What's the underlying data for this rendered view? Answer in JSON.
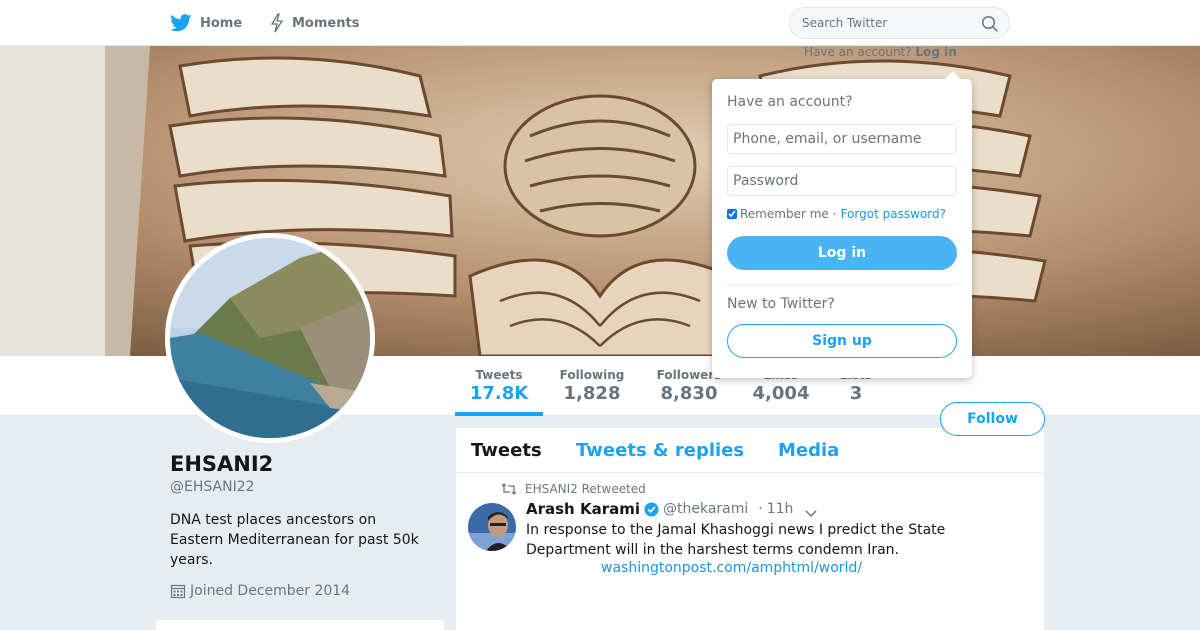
{
  "nav": {
    "home_label": "Home",
    "moments_label": "Moments",
    "search_placeholder": "Search Twitter",
    "login_prompt": "Have an account?",
    "login_link": "Log in"
  },
  "profile": {
    "name": "EHSANI2",
    "handle": "@EHSANI22",
    "bio": "DNA test places ancestors on Eastern Mediterranean for past 50k years.",
    "joined": "Joined December 2014",
    "follow_label": "Follow"
  },
  "stats": [
    {
      "label": "Tweets",
      "value": "17.8K"
    },
    {
      "label": "Following",
      "value": "1,828"
    },
    {
      "label": "Followers",
      "value": "8,830"
    },
    {
      "label": "Likes",
      "value": "4,004"
    },
    {
      "label": "Lists",
      "value": "3"
    }
  ],
  "tabs": [
    "Tweets",
    "Tweets & replies",
    "Media"
  ],
  "tweet": {
    "retweet_context": "EHSANI2 Retweeted",
    "author_name": "Arash Karami",
    "author_handle": "@thekarami",
    "time": "11h",
    "text": "In response to the Jamal Khashoggi news I predict the State Department will in the harshest terms condemn Iran.",
    "link": "washingtonpost.com/amphtml/world/"
  },
  "login_dropdown": {
    "heading": "Have an account?",
    "username_placeholder": "Phone, email, or username",
    "password_placeholder": "Password",
    "remember_label": "Remember me",
    "separator": "·",
    "forgot_label": "Forgot password?",
    "login_button": "Log in",
    "new_heading": "New to Twitter?",
    "signup_button": "Sign up"
  },
  "colors": {
    "accent": "#1da1f2",
    "background": "#e6ecf0",
    "muted_text": "#657786"
  }
}
